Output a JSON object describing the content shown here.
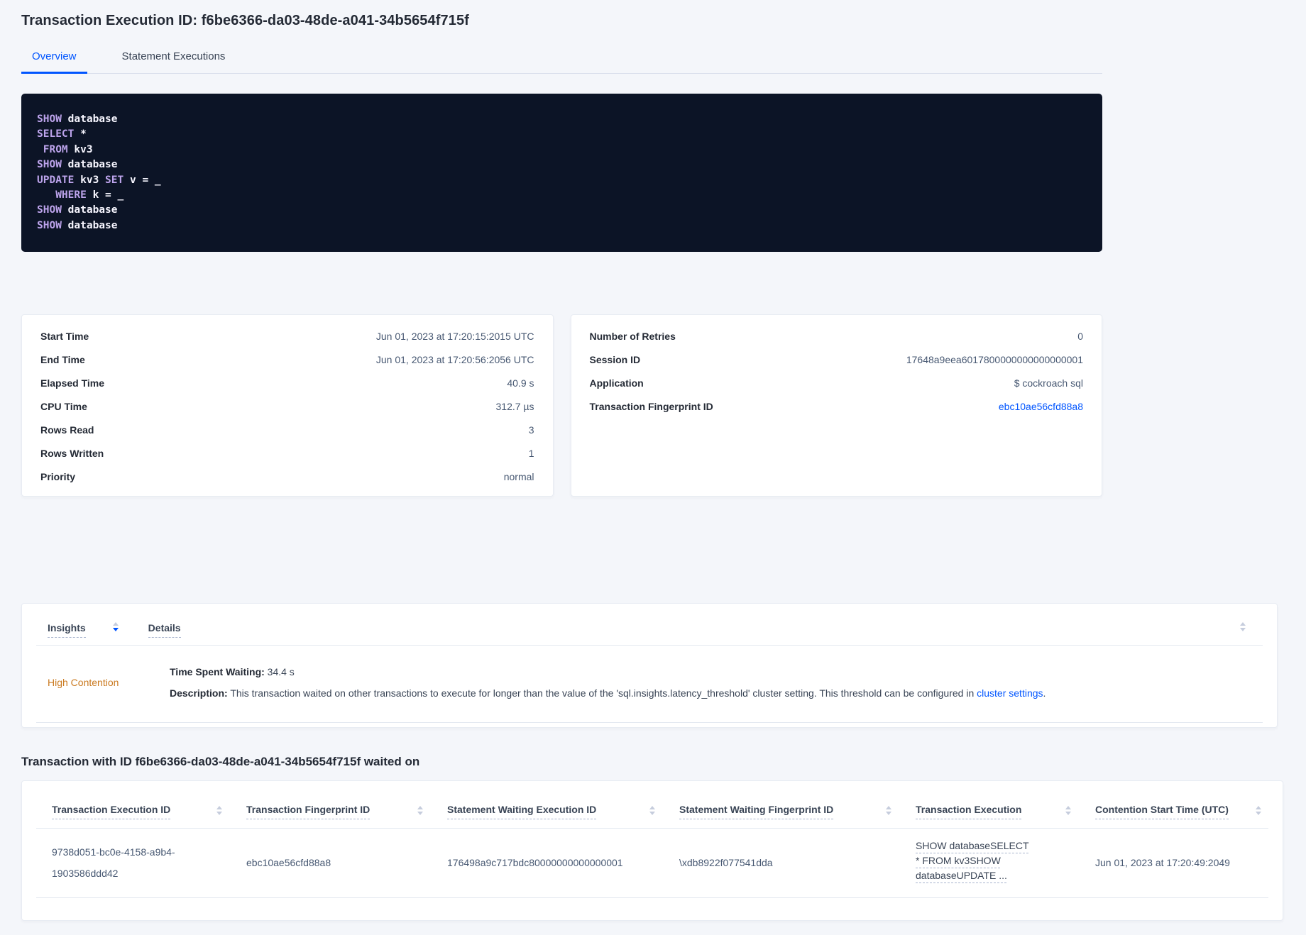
{
  "header": {
    "title": "Transaction Execution ID: f6be6366-da03-48de-a041-34b5654f715f"
  },
  "tabs": {
    "overview": "Overview",
    "statement_executions": "Statement Executions"
  },
  "sql": {
    "lines": [
      [
        {
          "text": "SHOW",
          "kw": true
        },
        {
          "text": " database",
          "kw": false
        }
      ],
      [
        {
          "text": "SELECT",
          "kw": true
        },
        {
          "text": " *",
          "kw": false
        }
      ],
      [
        {
          "text": " FROM",
          "kw": true
        },
        {
          "text": " kv3",
          "kw": false
        }
      ],
      [
        {
          "text": "SHOW",
          "kw": true
        },
        {
          "text": " database",
          "kw": false
        }
      ],
      [
        {
          "text": "UPDATE",
          "kw": true
        },
        {
          "text": " kv3 ",
          "kw": false
        },
        {
          "text": "SET",
          "kw": true
        },
        {
          "text": " v = _",
          "kw": false
        }
      ],
      [
        {
          "text": "   WHERE",
          "kw": true
        },
        {
          "text": " k = _",
          "kw": false
        }
      ],
      [
        {
          "text": "SHOW",
          "kw": true
        },
        {
          "text": " database",
          "kw": false
        }
      ],
      [
        {
          "text": "SHOW",
          "kw": true
        },
        {
          "text": " database",
          "kw": false
        }
      ]
    ]
  },
  "summary_left": {
    "rows": [
      {
        "label": "Start Time",
        "value": "Jun 01, 2023 at 17:20:15:2015 UTC"
      },
      {
        "label": "End Time",
        "value": "Jun 01, 2023 at 17:20:56:2056 UTC"
      },
      {
        "label": "Elapsed Time",
        "value": "40.9 s"
      },
      {
        "label": "CPU Time",
        "value": "312.7 µs"
      },
      {
        "label": "Rows Read",
        "value": "3"
      },
      {
        "label": "Rows Written",
        "value": "1"
      },
      {
        "label": "Priority",
        "value": "normal"
      }
    ]
  },
  "summary_right": {
    "rows": [
      {
        "label": "Number of Retries",
        "value": "0"
      },
      {
        "label": "Session ID",
        "value": "17648a9eea6017800000000000000001"
      },
      {
        "label": "Application",
        "value": "$ cockroach sql"
      },
      {
        "label": "Transaction Fingerprint ID",
        "value": "ebc10ae56cfd88a8"
      }
    ]
  },
  "insights": {
    "col_insights": "Insights",
    "col_details": "Details",
    "row": {
      "name": "High Contention",
      "waiting_label": "Time Spent Waiting:",
      "waiting_value": " 34.4 s",
      "desc_label": "Description:",
      "desc_text": " This transaction waited on other transactions to execute for longer than the value of the 'sql.insights.latency_threshold' cluster setting. This threshold can be configured in ",
      "desc_link": "cluster settings",
      "desc_suffix": "."
    }
  },
  "waited_on": {
    "heading": "Transaction with ID f6be6366-da03-48de-a041-34b5654f715f waited on",
    "columns": [
      "Transaction Execution ID",
      "Transaction Fingerprint ID",
      "Statement Waiting Execution ID",
      "Statement Waiting Fingerprint ID",
      "Transaction Execution",
      "Contention Start Time (UTC)"
    ],
    "row": {
      "transaction_execution_id": "9738d051-bc0e-4158-a9b4-1903586ddd42",
      "transaction_fingerprint_id": "ebc10ae56cfd88a8",
      "statement_waiting_execution_id": "176498a9c717bdc80000000000000001",
      "statement_waiting_fingerprint_id": "\\xdb8922f077541dda",
      "transaction_execution": "SHOW databaseSELECT * FROM kv3SHOW databaseUPDATE ...",
      "contention_start_time": "Jun 01, 2023 at 17:20:49:2049"
    }
  },
  "colors": {
    "accent_blue": "#0055ff",
    "insight_warning_orange": "#ca7a20",
    "code_background": "#0c1426",
    "code_keyword_purple": "#bda4ec"
  }
}
